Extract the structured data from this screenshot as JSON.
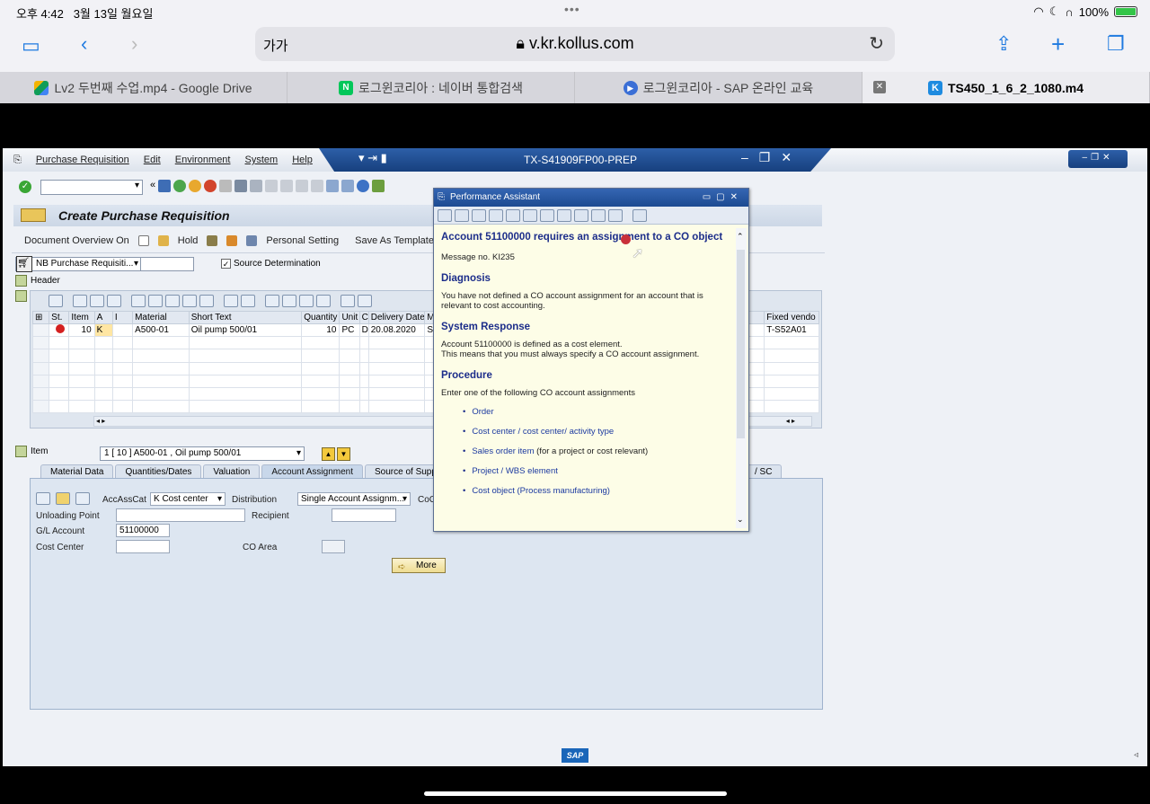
{
  "status": {
    "time": "오후 4:42",
    "date": "3월 13일 월요일",
    "battery": "100%",
    "battery_level": 1.0
  },
  "browser": {
    "address_prefix": "가가",
    "url": "v.kr.kollus.com",
    "tabs": [
      {
        "label": "Lv2 두번째 수업.mp4 - Google Drive",
        "icon": "google-drive-icon"
      },
      {
        "label": "로그윈코리아 : 네이버 통합검색",
        "icon": "naver-icon"
      },
      {
        "label": "로그윈코리아 - SAP 온라인 교육",
        "icon": "play-icon"
      },
      {
        "label": "TS450_1_6_2_1080.m4",
        "icon": "kollus-icon"
      }
    ]
  },
  "sap": {
    "menu": [
      "Purchase Requisition",
      "Edit",
      "Environment",
      "System",
      "Help"
    ],
    "system_title": "TX-S41909FP00-PREP",
    "screen_title": "Create Purchase Requisition",
    "appbar": [
      "Document Overview On",
      "Hold",
      "Personal Setting",
      "Save As Template"
    ],
    "doc_type": "NB Purchase Requisiti...",
    "source_determination": "Source Determination",
    "header_label": "Header",
    "grid": {
      "columns": [
        "St.",
        "Item",
        "A",
        "I",
        "Material",
        "Short Text",
        "Quantity",
        "Unit",
        "C",
        "Delivery Date",
        "Ma",
        "Fixed vendo"
      ],
      "row": {
        "item": "10",
        "a": "K",
        "material": "A500-01",
        "short_text": "Oil pump 500/01",
        "quantity": "10",
        "unit": "PC",
        "c": "D",
        "delivery_date": "20.08.2020",
        "ma": "Se",
        "fixed_vendor": "T-S52A01"
      }
    },
    "item_label": "Item",
    "item_select": "1 [ 10 ] A500-01 , Oil pump 500/01",
    "tabs": [
      "Material Data",
      "Quantities/Dates",
      "Valuation",
      "Account Assignment",
      "Source of Supply",
      "/ SC"
    ],
    "account": {
      "acc_ass_cat_label": "AccAssCat",
      "acc_ass_cat_value": "K Cost center",
      "distribution_label": "Distribution",
      "distribution_value": "Single Account Assignm...",
      "co_label": "CoC",
      "unloading_label": "Unloading Point",
      "recipient_label": "Recipient",
      "gl_label": "G/L Account",
      "gl_value": "51100000",
      "cost_center_label": "Cost Center",
      "co_area_label": "CO Area",
      "more_label": "More"
    },
    "logo": "SAP"
  },
  "assistant": {
    "title": "Performance Assistant",
    "heading": "Account 51100000 requires an assignment to a CO object",
    "message_no": "Message no. KI235",
    "diagnosis_h": "Diagnosis",
    "diagnosis_t": "You have not defined a CO account assignment for an account that is relevant to cost accounting.",
    "response_h": "System Response",
    "response_t1": "Account 51100000 is defined as a cost element.",
    "response_t2": "This means that you must always specify a CO account assignment.",
    "procedure_h": "Procedure",
    "procedure_t": "Enter one of the following CO account assignments",
    "items": [
      {
        "link": "Order",
        "note": ""
      },
      {
        "link": "Cost center / cost center/ activity type",
        "note": ""
      },
      {
        "link": "Sales order item",
        "note": " (for a project or cost relevant)"
      },
      {
        "link": "Project / WBS element",
        "note": ""
      },
      {
        "link": "Cost object (Process manufacturing)",
        "note": ""
      }
    ]
  }
}
